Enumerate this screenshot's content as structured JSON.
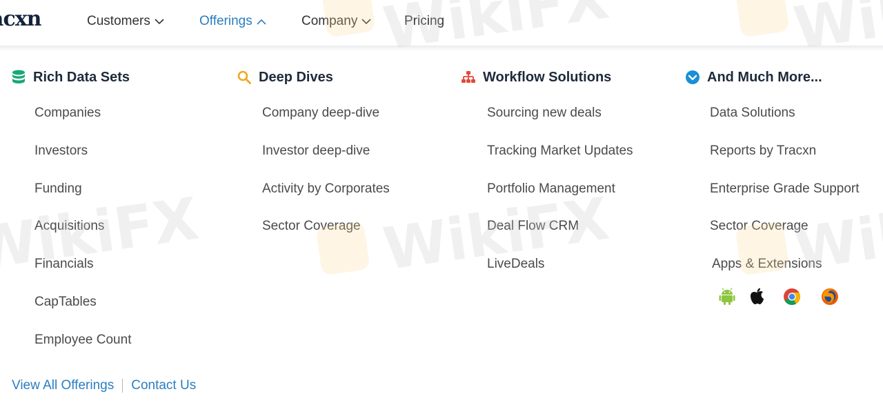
{
  "brand": {
    "logo_text": "acxn"
  },
  "nav": {
    "items": [
      {
        "label": "Customers",
        "has_chevron": true,
        "expanded": false
      },
      {
        "label": "Offerings",
        "has_chevron": true,
        "expanded": true
      },
      {
        "label": "Company",
        "has_chevron": true,
        "expanded": false
      },
      {
        "label": "Pricing",
        "has_chevron": false,
        "expanded": false
      }
    ]
  },
  "menu": {
    "columns": [
      {
        "title": "Rich Data Sets",
        "icon": "database-icon",
        "icon_color": "#1aa77a",
        "links": [
          "Companies",
          "Investors",
          "Funding",
          "Acquisitions",
          "Financials",
          "CapTables",
          "Employee Count"
        ]
      },
      {
        "title": "Deep Dives",
        "icon": "search-icon",
        "icon_color": "#f0a820",
        "links": [
          "Company deep-dive",
          "Investor deep-dive",
          "Activity by Corporates",
          "Sector Coverage"
        ]
      },
      {
        "title": "Workflow Solutions",
        "icon": "sitemap-icon",
        "icon_color": "#e04a3a",
        "links": [
          "Sourcing new deals",
          "Tracking Market Updates",
          "Portfolio Management",
          "Deal Flow CRM",
          "LiveDeals"
        ]
      },
      {
        "title": "And Much More...",
        "icon": "check-circle-icon",
        "icon_color": "#1a8fd6",
        "links": [
          "Data Solutions",
          "Reports by Tracxn",
          "Enterprise Grade Support",
          "Sector Coverage",
          "Apps & Extensions"
        ]
      }
    ],
    "apps": [
      "android-icon",
      "apple-icon",
      "chrome-icon",
      "firefox-icon"
    ]
  },
  "footer": {
    "view_all": "View All Offerings",
    "contact": "Contact Us"
  },
  "watermark": "WikiFX",
  "colors": {
    "accent": "#2a7dc2",
    "heading": "#1e2a3a",
    "link": "#4a4a4a"
  }
}
